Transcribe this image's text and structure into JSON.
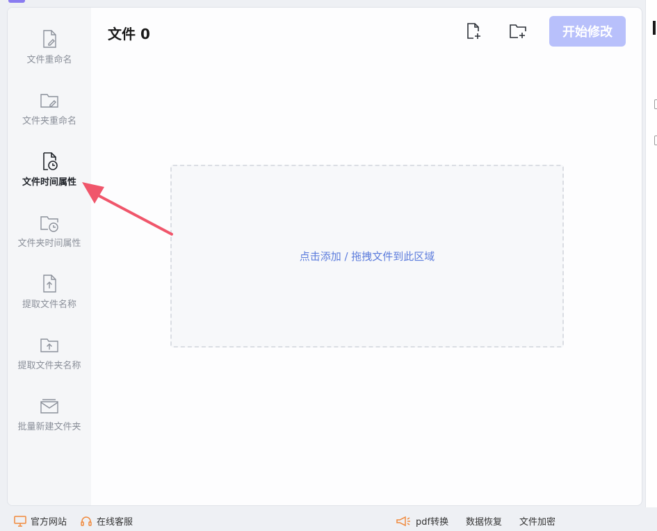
{
  "header": {
    "title": "文件 0",
    "start_button": "开始修改"
  },
  "sidebar": {
    "items": [
      {
        "label": "文件重命名",
        "icon": "file-edit-icon",
        "active": false
      },
      {
        "label": "文件夹重命名",
        "icon": "folder-edit-icon",
        "active": false
      },
      {
        "label": "文件时间属性",
        "icon": "file-clock-icon",
        "active": true
      },
      {
        "label": "文件夹时间属性",
        "icon": "folder-clock-icon",
        "active": false
      },
      {
        "label": "提取文件名称",
        "icon": "file-upload-icon",
        "active": false
      },
      {
        "label": "提取文件夹名称",
        "icon": "folder-upload-icon",
        "active": false
      },
      {
        "label": "批量新建文件夹",
        "icon": "folder-batch-icon",
        "active": false
      }
    ]
  },
  "drop_zone": {
    "text": "点击添加 / 拖拽文件到此区域"
  },
  "footer": {
    "left": [
      {
        "label": "官方网站",
        "icon": "monitor-icon"
      },
      {
        "label": "在线客服",
        "icon": "headset-icon"
      }
    ],
    "right": [
      {
        "label": "pdf转换",
        "icon": "megaphone-icon"
      },
      {
        "label": "数据恢复"
      },
      {
        "label": "文件加密"
      }
    ]
  },
  "colors": {
    "accent": "#b8c0fb",
    "link": "#5b7bdc",
    "arrow": "#f0566b"
  }
}
